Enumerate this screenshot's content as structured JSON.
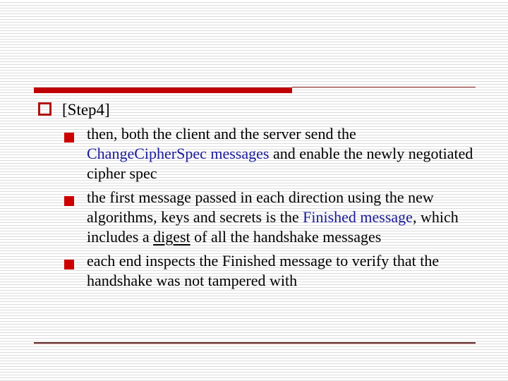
{
  "slide": {
    "colors": {
      "accent_red": "#c00000",
      "bullet_red": "#cc0000",
      "highlight_blue": "#1a1a99",
      "text": "#000000"
    },
    "heading_item": {
      "bullet_icon": "hollow-square",
      "label": "[Step4]"
    },
    "sub_items": [
      {
        "bullet_icon": "filled-square",
        "parts": [
          {
            "text": "then, both the client and the server send the ",
            "style": "normal"
          },
          {
            "text": "ChangeCipherSpec messages",
            "style": "blue"
          },
          {
            "text": " and enable the newly negotiated cipher spec",
            "style": "normal"
          }
        ]
      },
      {
        "bullet_icon": "filled-square",
        "parts": [
          {
            "text": "the first message passed in each direction using the new algorithms, keys and secrets is the ",
            "style": "normal"
          },
          {
            "text": "Finished message",
            "style": "blue"
          },
          {
            "text": ", which includes a ",
            "style": "normal"
          },
          {
            "text": "digest",
            "style": "underline"
          },
          {
            "text": " of all the handshake messages",
            "style": "normal"
          }
        ]
      },
      {
        "bullet_icon": "filled-square",
        "parts": [
          {
            "text": "each end inspects the Finished message to verify that the handshake was not tampered with",
            "style": "normal"
          }
        ]
      }
    ]
  }
}
